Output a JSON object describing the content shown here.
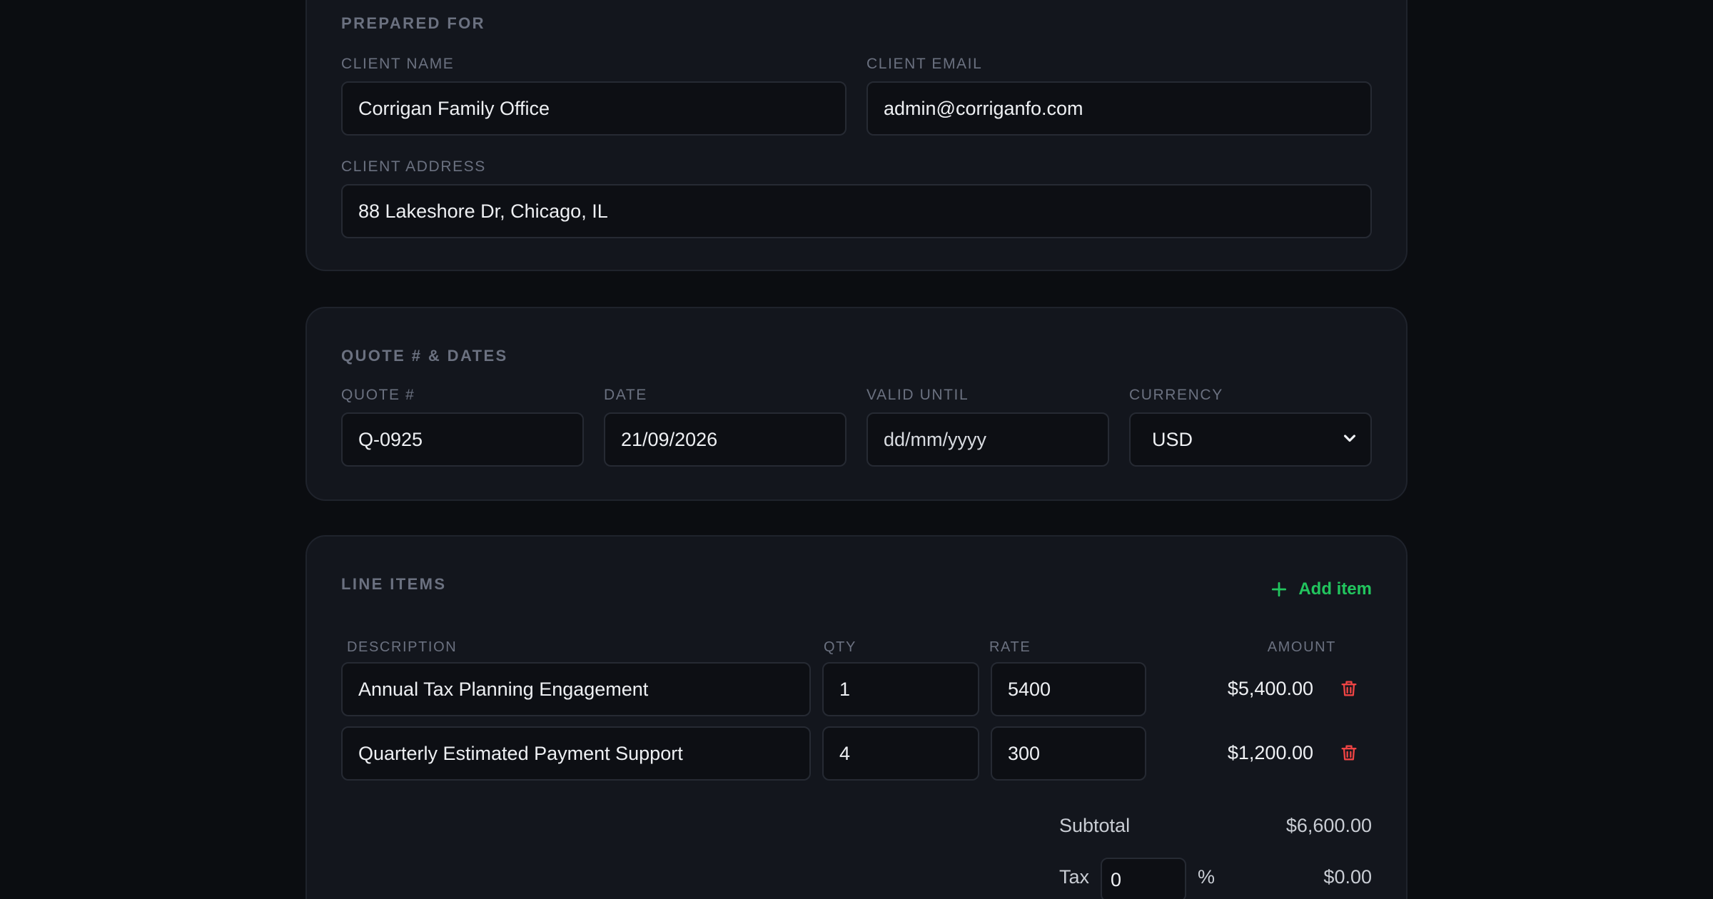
{
  "prepared_for": {
    "title": "PREPARED FOR",
    "client_name_label": "CLIENT NAME",
    "client_name": "Corrigan Family Office",
    "client_email_label": "CLIENT EMAIL",
    "client_email": "admin@corriganfo.com",
    "client_address_label": "CLIENT ADDRESS",
    "client_address": "88 Lakeshore Dr, Chicago, IL"
  },
  "quote_dates": {
    "title": "QUOTE # & DATES",
    "quote_label": "QUOTE #",
    "quote_number": "Q-0925",
    "date_label": "DATE",
    "date": "21/09/2026",
    "valid_until_label": "VALID UNTIL",
    "valid_until_placeholder": "dd/mm/yyyy",
    "currency_label": "CURRENCY",
    "currency": "USD"
  },
  "line_items": {
    "title": "LINE ITEMS",
    "add_item_label": "Add item",
    "columns": {
      "description": "DESCRIPTION",
      "qty": "QTY",
      "rate": "RATE",
      "amount": "AMOUNT"
    },
    "rows": [
      {
        "description": "Annual Tax Planning Engagement",
        "qty": "1",
        "rate": "5400",
        "amount": "$5,400.00"
      },
      {
        "description": "Quarterly Estimated Payment Support",
        "qty": "4",
        "rate": "300",
        "amount": "$1,200.00"
      }
    ],
    "subtotal_label": "Subtotal",
    "subtotal": "$6,600.00",
    "tax_label": "Tax",
    "tax_rate": "0",
    "tax_unit": "%",
    "tax_amount": "$0.00"
  },
  "colors": {
    "background": "#0b0d11",
    "card": "#13161d",
    "accent_green": "#22c55e",
    "danger_red": "#ef4444"
  },
  "icons": {
    "add": "plus-icon",
    "delete": "trash-icon",
    "select": "chevron-down-icon"
  }
}
